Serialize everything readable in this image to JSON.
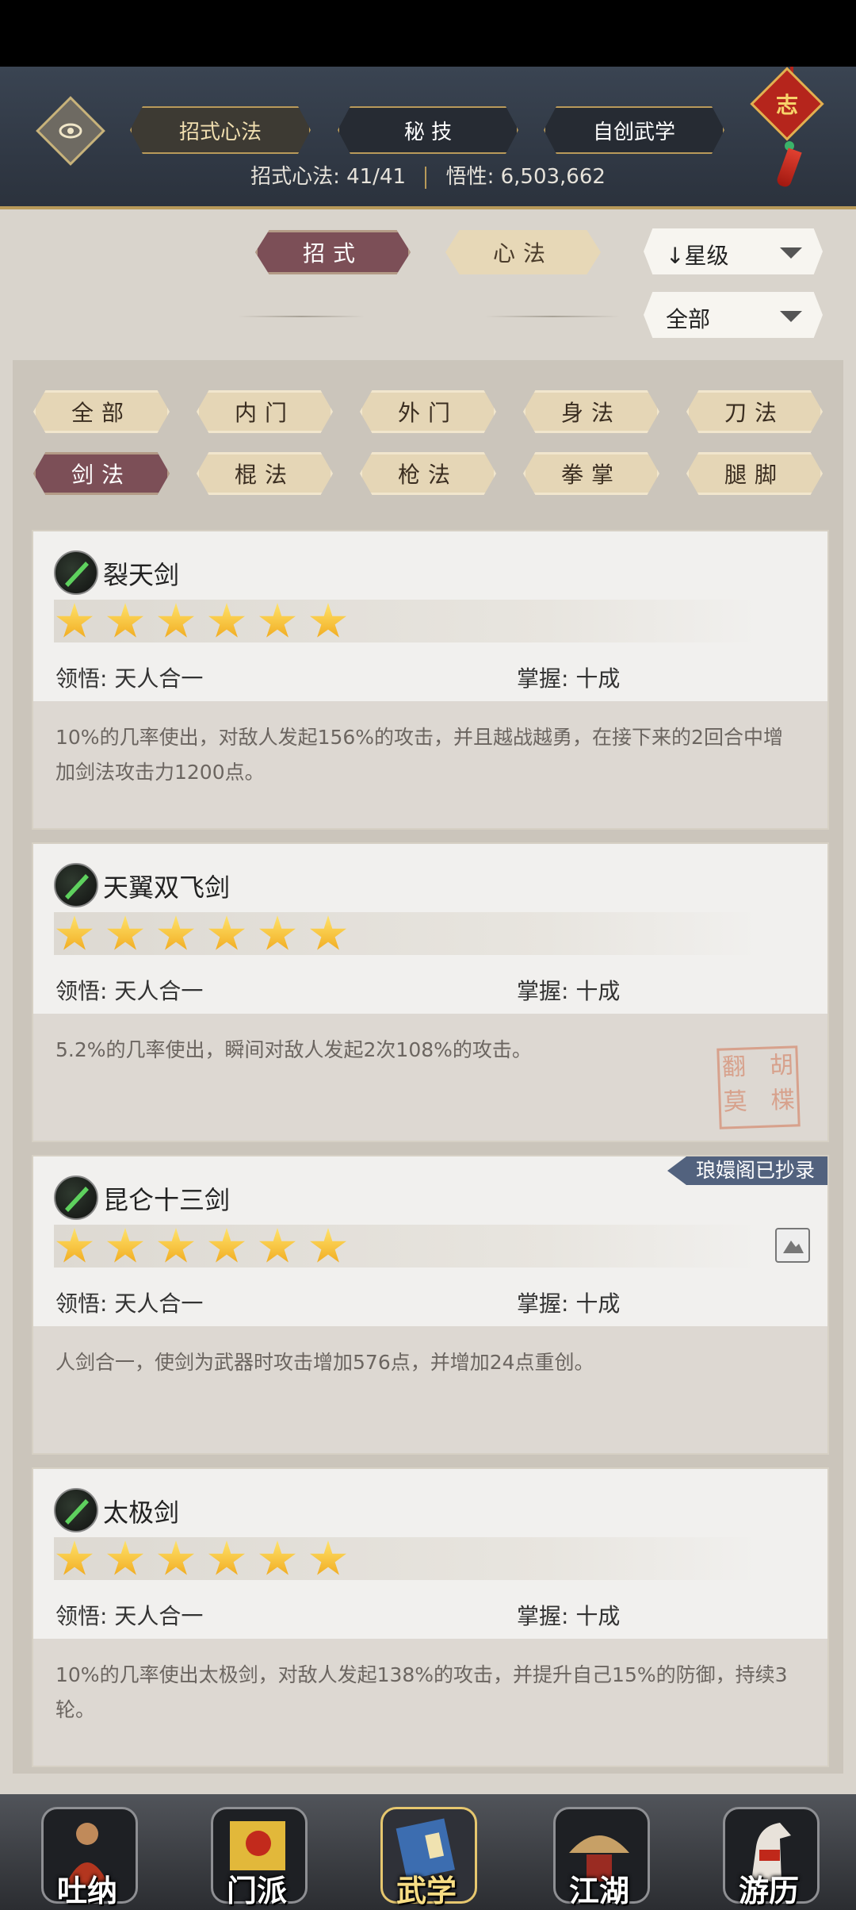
{
  "header": {
    "tabs": [
      {
        "label": "招式心法",
        "active": true
      },
      {
        "label": "秘 技",
        "active": false
      },
      {
        "label": "自创武学",
        "active": false
      }
    ],
    "stats_label_moves": "招式心法:",
    "stats_value_moves": "41/41",
    "stats_label_insight": "悟性:",
    "stats_value_insight": "6,503,662",
    "zhi_badge": "志"
  },
  "subtabs": [
    {
      "label": "招式",
      "active": true
    },
    {
      "label": "心法",
      "active": false
    }
  ],
  "sort_dropdown": {
    "label": "↓星级"
  },
  "filter_dropdown": {
    "label": "全部"
  },
  "filters": [
    {
      "label": "全部",
      "active": false
    },
    {
      "label": "内门",
      "active": false
    },
    {
      "label": "外门",
      "active": false
    },
    {
      "label": "身法",
      "active": false
    },
    {
      "label": "刀法",
      "active": false
    },
    {
      "label": "剑法",
      "active": true
    },
    {
      "label": "棍法",
      "active": false
    },
    {
      "label": "枪法",
      "active": false
    },
    {
      "label": "拳掌",
      "active": false
    },
    {
      "label": "腿脚",
      "active": false
    }
  ],
  "skills": [
    {
      "name": "裂天剑",
      "stars": 6,
      "ling": "领悟: 天人合一",
      "zhang": "掌握: 十成",
      "desc": "10%的几率使出，对敌人发起156%的攻击，并且越战越勇，在接下来的2回合中增加剑法攻击力1200点。"
    },
    {
      "name": "天翼双飞剑",
      "stars": 6,
      "ling": "领悟: 天人合一",
      "zhang": "掌握: 十成",
      "desc": "5.2%的几率使出，瞬间对敌人发起2次108%的攻击。"
    },
    {
      "name": "昆仑十三剑",
      "stars": 6,
      "ling": "领悟: 天人合一",
      "zhang": "掌握: 十成",
      "desc": "人剑合一，使剑为武器时攻击增加576点，并增加24点重创。",
      "badge": "琅嬛阁已抄录"
    },
    {
      "name": "太极剑",
      "stars": 6,
      "ling": "领悟: 天人合一",
      "zhang": "掌握: 十成",
      "desc": "10%的几率使出太极剑，对敌人发起138%的攻击，并提升自己15%的防御，持续3轮。"
    }
  ],
  "seal_text": "翻　胡\n莫　楪",
  "bottom_nav": [
    {
      "label": "吐纳",
      "active": false
    },
    {
      "label": "门派",
      "active": false
    },
    {
      "label": "武学",
      "active": true
    },
    {
      "label": "江湖",
      "active": false
    },
    {
      "label": "游历",
      "active": false
    }
  ],
  "colors": {
    "accent": "#7c4f57",
    "gold": "#b99a5a",
    "star": "#f0a81c",
    "badge": "#52627e"
  }
}
